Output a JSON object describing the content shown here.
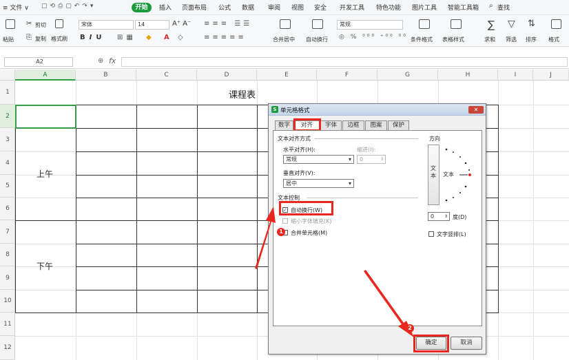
{
  "menubar": {
    "file": "≡ 文件 ∨",
    "start": "开始",
    "tabs": [
      "插入",
      "页面布局",
      "公式",
      "数据",
      "审阅",
      "视图",
      "安全",
      "开发工具",
      "特色功能",
      "图片工具",
      "智能工具箱"
    ],
    "search": "查找"
  },
  "toolbar": {
    "paste": "粘贴",
    "cut": "剪切",
    "copy": "复制",
    "format_painter": "格式刷",
    "font_name": "宋体",
    "font_size": "14",
    "merge_center": "合并居中",
    "wrap_text": "自动换行",
    "number_format": "常规",
    "conditional_format": "条件格式",
    "table_style": "表格样式",
    "sum": "求和",
    "filter": "筛选",
    "sort": "排序",
    "format": "格式"
  },
  "formula": {
    "cell_ref": "A2",
    "fx": "fx"
  },
  "columns": [
    "A",
    "B",
    "C",
    "D",
    "E",
    "F",
    "G",
    "H",
    "I",
    "J"
  ],
  "rows": [
    "1",
    "2",
    "3",
    "4",
    "5",
    "6",
    "7",
    "8",
    "9",
    "10",
    "11",
    "12"
  ],
  "sheet": {
    "title": "课程表",
    "morning": "上午",
    "afternoon": "下午"
  },
  "dialog": {
    "title": "单元格格式",
    "tabs": [
      "数字",
      "对齐",
      "字体",
      "边框",
      "图案",
      "保护"
    ],
    "alignment_section": "文本对齐方式",
    "horizontal_label": "水平对齐(H):",
    "horizontal_value": "常规",
    "indent_label": "缩进(I):",
    "indent_value": "0",
    "vertical_label": "垂直对齐(V):",
    "vertical_value": "居中",
    "control_section": "文本控制",
    "wrap_label": "自动换行(W)",
    "shrink_label": "缩小字体填充(K)",
    "merge_label": "合并单元格(M)",
    "orientation_section": "方向",
    "vertical_text": "文本",
    "orientation_text": "文本",
    "degree_value": "0",
    "degree_label": "度(D)",
    "vertical_stack_label": "文字竖排(L)",
    "ok": "确定",
    "cancel": "取消"
  },
  "annotations": {
    "step1": "1",
    "step2": "2"
  },
  "colors": {
    "accent": "#1a9b3c",
    "highlight": "#e8271f",
    "selection": "#2f9e44"
  }
}
